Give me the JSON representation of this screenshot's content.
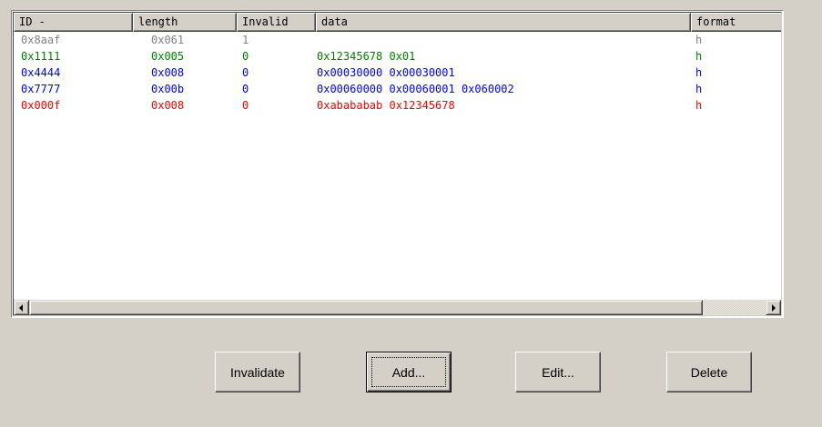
{
  "colors": {
    "gray": "#808080",
    "green": "#008000",
    "blue": "#0000ff",
    "red": "#ff0000"
  },
  "table": {
    "columns": [
      "ID -",
      "length",
      "Invalid",
      "data",
      "format"
    ],
    "rows": [
      {
        "id": "0x8aaf",
        "length": "0x061",
        "invalid": "1",
        "data": "",
        "format": "h",
        "color": "#808080"
      },
      {
        "id": "0x1111",
        "length": "0x005",
        "invalid": "0",
        "data": "0x12345678 0x01",
        "format": "h",
        "color": "#008000"
      },
      {
        "id": "0x4444",
        "length": "0x008",
        "invalid": "0",
        "data": "0x00030000 0x00030001",
        "format": "h",
        "color": "#0000ff"
      },
      {
        "id": "0x7777",
        "length": "0x00b",
        "invalid": "0",
        "data": "0x00060000 0x00060001 0x060002",
        "format": "h",
        "color": "#0000ff"
      },
      {
        "id": "0x000f",
        "length": "0x008",
        "invalid": "0",
        "data": "0xabababab 0x12345678",
        "format": "h",
        "color": "#ff0000"
      }
    ]
  },
  "icons": {
    "scroll_left": "triangle-left-icon",
    "scroll_right": "triangle-right-icon"
  },
  "buttons": {
    "invalidate": "Invalidate",
    "add": "Add...",
    "edit": "Edit...",
    "delete": "Delete"
  }
}
